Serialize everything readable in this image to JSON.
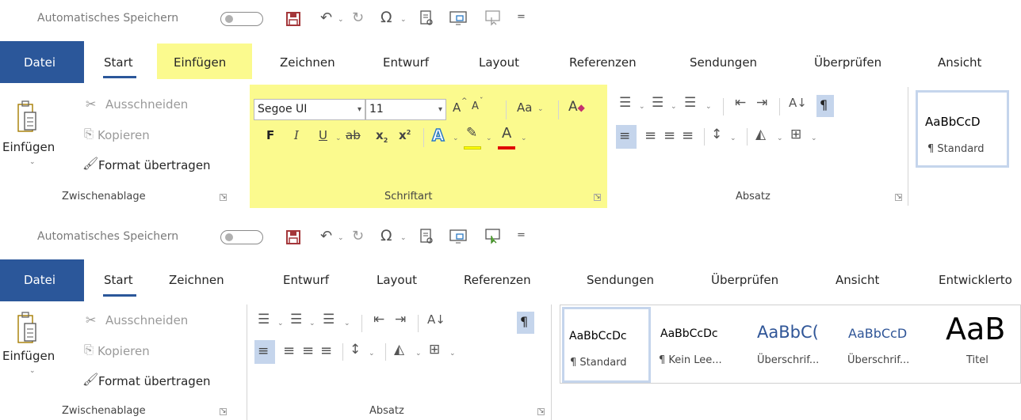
{
  "top": {
    "qat": {
      "autosave_label": "Automatisches Speichern",
      "more_label": "="
    },
    "tabs": [
      "Datei",
      "Start",
      "Einfügen",
      "Zeichnen",
      "Entwurf",
      "Layout",
      "Referenzen",
      "Sendungen",
      "Überprüfen",
      "Ansicht"
    ],
    "clipboard": {
      "paste_label": "Einfügen",
      "cut_label": "Ausschneiden",
      "copy_label": "Kopieren",
      "format_painter_label": "Format übertragen",
      "group_label": "Zwischenablage"
    },
    "font": {
      "font_name": "Segoe UI",
      "font_size": "11",
      "grow_label": "A",
      "shrink_label": "A",
      "case_label": "Aa",
      "bold_label": "F",
      "italic_label": "I",
      "underline_label": "U",
      "strike_label": "ab",
      "subscript_label": "x",
      "superscript_label": "x",
      "text_effects_label": "A",
      "font_color_label": "A",
      "group_label": "Schriftart"
    },
    "paragraph": {
      "sort_label": "A↓",
      "pilcrow_label": "¶",
      "group_label": "Absatz"
    },
    "styles": [
      {
        "sample": "AaBbCcD",
        "name": "¶ Standard"
      }
    ]
  },
  "bottom": {
    "qat": {
      "autosave_label": "Automatisches Speichern",
      "more_label": "="
    },
    "tabs": [
      "Datei",
      "Start",
      "Zeichnen",
      "Entwurf",
      "Layout",
      "Referenzen",
      "Sendungen",
      "Überprüfen",
      "Ansicht",
      "Entwicklerto"
    ],
    "clipboard": {
      "paste_label": "Einfügen",
      "cut_label": "Ausschneiden",
      "copy_label": "Kopieren",
      "format_painter_label": "Format übertragen",
      "group_label": "Zwischenablage"
    },
    "paragraph": {
      "sort_label": "A↓",
      "pilcrow_label": "¶",
      "group_label": "Absatz"
    },
    "styles": [
      {
        "sample": "AaBbCcDc",
        "name": "¶ Standard"
      },
      {
        "sample": "AaBbCcDc",
        "name": "¶ Kein Lee..."
      },
      {
        "sample": "AaBbC(",
        "name": "Überschrif..."
      },
      {
        "sample": "AaBbCcD",
        "name": "Überschrif..."
      },
      {
        "sample": "AaB",
        "name": "Titel"
      }
    ]
  },
  "colors": {
    "file_tab": "#2b579a",
    "highlight": "#fbfa8e",
    "save_icon": "#a4373a",
    "font_color_bar": "#e00000",
    "highlighter_bar": "#ffff00",
    "heading_blue": "#2f5597"
  }
}
